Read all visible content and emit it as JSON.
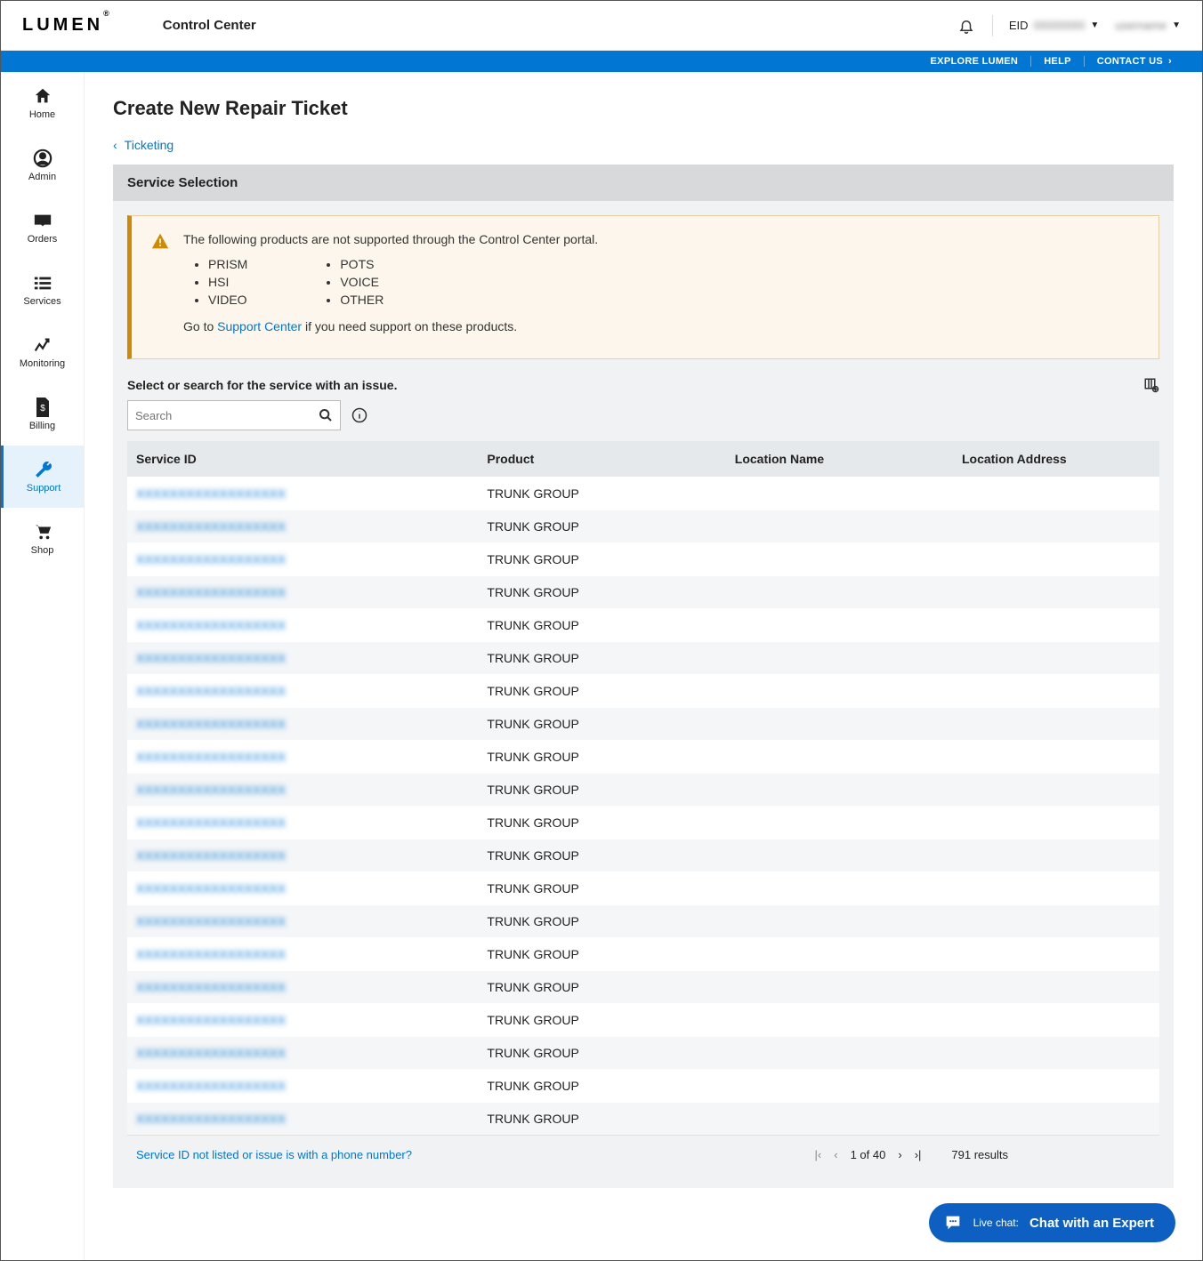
{
  "brand": "LUMEN",
  "brand_mark": "®",
  "app_name": "Control Center",
  "user": {
    "eid_label": "EID",
    "eid_value": "00000000",
    "name": "username"
  },
  "top_links": {
    "explore": "EXPLORE LUMEN",
    "help": "HELP",
    "contact": "CONTACT US"
  },
  "nav": {
    "home": "Home",
    "admin": "Admin",
    "orders": "Orders",
    "services": "Services",
    "monitoring": "Monitoring",
    "billing": "Billing",
    "support": "Support",
    "shop": "Shop"
  },
  "page": {
    "title": "Create New Repair Ticket",
    "breadcrumb": "Ticketing",
    "panel_title": "Service Selection"
  },
  "alert": {
    "message": "The following products are not supported through the Control Center portal.",
    "col1": [
      "PRISM",
      "HSI",
      "VIDEO"
    ],
    "col2": [
      "POTS",
      "VOICE",
      "OTHER"
    ],
    "footer_pre": "Go to ",
    "footer_link": "Support Center",
    "footer_post": " if you need support on these products."
  },
  "search": {
    "label": "Select or search for the service with an issue.",
    "placeholder": "Search"
  },
  "table": {
    "headers": {
      "service_id": "Service ID",
      "product": "Product",
      "location_name": "Location Name",
      "location_address": "Location Address"
    },
    "rows": [
      {
        "id": "XXXXXXXXXXXXXXXXXX",
        "product": "TRUNK GROUP"
      },
      {
        "id": "XXXXXXXXXXXXXXXXXX",
        "product": "TRUNK GROUP"
      },
      {
        "id": "XXXXXXXXXXXXXXXXXX",
        "product": "TRUNK GROUP"
      },
      {
        "id": "XXXXXXXXXXXXXXXXXX",
        "product": "TRUNK GROUP"
      },
      {
        "id": "XXXXXXXXXXXXXXXXXX",
        "product": "TRUNK GROUP"
      },
      {
        "id": "XXXXXXXXXXXXXXXXXX",
        "product": "TRUNK GROUP"
      },
      {
        "id": "XXXXXXXXXXXXXXXXXX",
        "product": "TRUNK GROUP"
      },
      {
        "id": "XXXXXXXXXXXXXXXXXX",
        "product": "TRUNK GROUP"
      },
      {
        "id": "XXXXXXXXXXXXXXXXXX",
        "product": "TRUNK GROUP"
      },
      {
        "id": "XXXXXXXXXXXXXXXXXX",
        "product": "TRUNK GROUP"
      },
      {
        "id": "XXXXXXXXXXXXXXXXXX",
        "product": "TRUNK GROUP"
      },
      {
        "id": "XXXXXXXXXXXXXXXXXX",
        "product": "TRUNK GROUP"
      },
      {
        "id": "XXXXXXXXXXXXXXXXXX",
        "product": "TRUNK GROUP"
      },
      {
        "id": "XXXXXXXXXXXXXXXXXX",
        "product": "TRUNK GROUP"
      },
      {
        "id": "XXXXXXXXXXXXXXXXXX",
        "product": "TRUNK GROUP"
      },
      {
        "id": "XXXXXXXXXXXXXXXXXX",
        "product": "TRUNK GROUP"
      },
      {
        "id": "XXXXXXXXXXXXXXXXXX",
        "product": "TRUNK GROUP"
      },
      {
        "id": "XXXXXXXXXXXXXXXXXX",
        "product": "TRUNK GROUP"
      },
      {
        "id": "XXXXXXXXXXXXXXXXXX",
        "product": "TRUNK GROUP"
      },
      {
        "id": "XXXXXXXXXXXXXXXXXX",
        "product": "TRUNK GROUP"
      }
    ]
  },
  "footer": {
    "not_listed": "Service ID not listed or issue is with a phone number?",
    "page_label": "1 of 40",
    "results": "791 results"
  },
  "chat": {
    "label": "Chat with an Expert",
    "prefix": "Live chat:"
  }
}
